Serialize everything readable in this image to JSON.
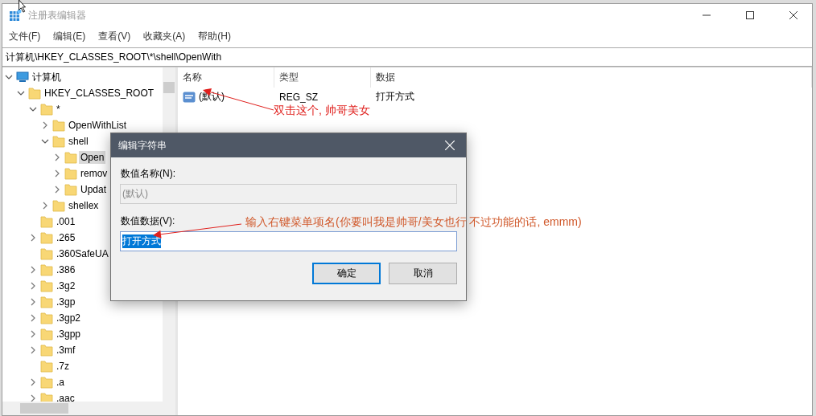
{
  "window": {
    "title": "注册表编辑器"
  },
  "menu": [
    "文件(F)",
    "编辑(E)",
    "查看(V)",
    "收藏夹(A)",
    "帮助(H)"
  ],
  "address": "计算机\\HKEY_CLASSES_ROOT\\*\\shell\\OpenWith",
  "tree": [
    {
      "label": "计算机",
      "kind": "computer",
      "expanded": true,
      "selected": false,
      "children": [
        {
          "label": "HKEY_CLASSES_ROOT",
          "kind": "folder",
          "expanded": true,
          "selected": false,
          "children": [
            {
              "label": "*",
              "kind": "folder",
              "expanded": true,
              "selected": false,
              "children": [
                {
                  "label": "OpenWithList",
                  "kind": "folder",
                  "expanded": false,
                  "selected": false
                },
                {
                  "label": "shell",
                  "kind": "folder",
                  "expanded": true,
                  "selected": false,
                  "children": [
                    {
                      "label": "Open",
                      "kind": "folder",
                      "expanded": false,
                      "selected": true
                    },
                    {
                      "label": "remov",
                      "kind": "folder",
                      "expanded": false,
                      "selected": false
                    },
                    {
                      "label": "Updat",
                      "kind": "folder",
                      "expanded": false,
                      "selected": false
                    }
                  ]
                },
                {
                  "label": "shellex",
                  "kind": "folder",
                  "expanded": false,
                  "selected": false
                }
              ]
            },
            {
              "label": ".001",
              "kind": "folder",
              "selected": false
            },
            {
              "label": ".265",
              "kind": "folder",
              "expanded": false,
              "selected": false
            },
            {
              "label": ".360SafeUA",
              "kind": "folder",
              "selected": false
            },
            {
              "label": ".386",
              "kind": "folder",
              "expanded": false,
              "selected": false
            },
            {
              "label": ".3g2",
              "kind": "folder",
              "expanded": false,
              "selected": false
            },
            {
              "label": ".3gp",
              "kind": "folder",
              "expanded": false,
              "selected": false
            },
            {
              "label": ".3gp2",
              "kind": "folder",
              "expanded": false,
              "selected": false
            },
            {
              "label": ".3gpp",
              "kind": "folder",
              "expanded": false,
              "selected": false
            },
            {
              "label": ".3mf",
              "kind": "folder",
              "expanded": false,
              "selected": false
            },
            {
              "label": ".7z",
              "kind": "folder",
              "selected": false
            },
            {
              "label": ".a",
              "kind": "folder",
              "expanded": false,
              "selected": false
            },
            {
              "label": ".aac",
              "kind": "folder",
              "expanded": false,
              "selected": false
            }
          ]
        }
      ]
    }
  ],
  "values_table": {
    "columns": [
      "名称",
      "类型",
      "数据"
    ],
    "rows": [
      {
        "name": "(默认)",
        "type": "REG_SZ",
        "data": "打开方式"
      }
    ]
  },
  "dialog": {
    "title": "编辑字符串",
    "fields": [
      {
        "label": "数值名称(N):",
        "value": "(默认)",
        "disabled": true,
        "highlighted": false
      },
      {
        "label": "数值数据(V):",
        "value": "打开方式",
        "disabled": false,
        "highlighted": true
      }
    ],
    "buttons": [
      {
        "label": "确定",
        "default": true
      },
      {
        "label": "取消",
        "default": false
      }
    ]
  },
  "annotations": [
    "双击这个, 帅哥美女",
    "输入右键菜单项名(你要叫我是帅哥/美女也行 不过功能的话, emmm)"
  ]
}
